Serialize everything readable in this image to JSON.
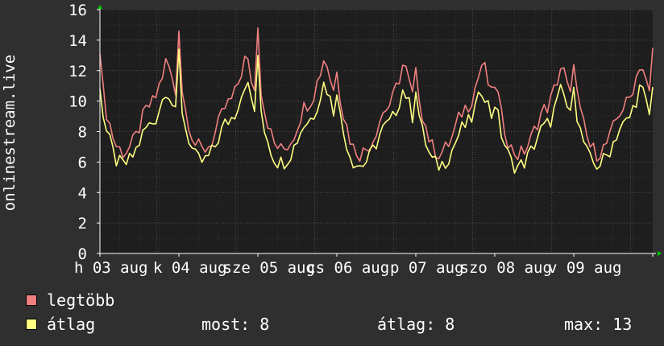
{
  "chart_data": {
    "type": "line",
    "ylabel": "onlinestream.live",
    "ylim": [
      0,
      16
    ],
    "yticks": [
      0,
      2,
      4,
      6,
      8,
      10,
      12,
      14,
      16
    ],
    "xlabels": [
      "h 03 aug",
      "k 04 aug",
      "sze 05 aug",
      "cs 06 aug",
      "p 07 aug",
      "szo 08 aug",
      "v 09 aug"
    ],
    "day_count": 7,
    "grid": true,
    "legend_placement": "bottom-left",
    "colors": {
      "background": "#2f2f2f",
      "plot_background": "#1e1e1e",
      "grid_major": "#5a4a4a",
      "grid_minor": "#3a3030",
      "axis": "#ffffff",
      "arrow": "#00cc00"
    },
    "series": [
      {
        "name": "legtöbb",
        "color": "#f07f7f",
        "daily_profile": [
          9.8,
          10.5,
          9.2,
          8.4,
          7.6,
          7.0,
          6.8,
          6.6,
          6.7,
          6.9,
          7.2,
          7.6,
          8.2,
          8.8,
          9.3,
          9.6,
          9.8,
          10.2,
          10.9,
          11.6,
          12.4,
          12.1,
          11.2,
          10.4
        ],
        "day_peaks": [
          13.1,
          14.6,
          14.8,
          11.9,
          12.2,
          10.9,
          12.4
        ],
        "end_peak": 14.2
      },
      {
        "name": "átlag",
        "color": "#ffff80",
        "daily_profile": [
          8.6,
          9.1,
          8.0,
          7.3,
          6.6,
          6.1,
          5.9,
          5.8,
          5.9,
          6.1,
          6.4,
          6.8,
          7.3,
          7.8,
          8.2,
          8.4,
          8.6,
          8.9,
          9.5,
          10.1,
          10.8,
          10.5,
          9.8,
          9.1
        ],
        "day_peaks": [
          10.8,
          13.4,
          13.0,
          10.4,
          10.6,
          9.6,
          10.9
        ],
        "end_peak": 11.5
      }
    ]
  },
  "legend": {
    "items": [
      {
        "label": "legtöbb",
        "color": "#f07f7f"
      },
      {
        "label": "átlag",
        "color": "#ffff80"
      }
    ]
  },
  "stats": {
    "most": "most: 8",
    "atlag": "átlag: 8",
    "max": "max: 13"
  }
}
